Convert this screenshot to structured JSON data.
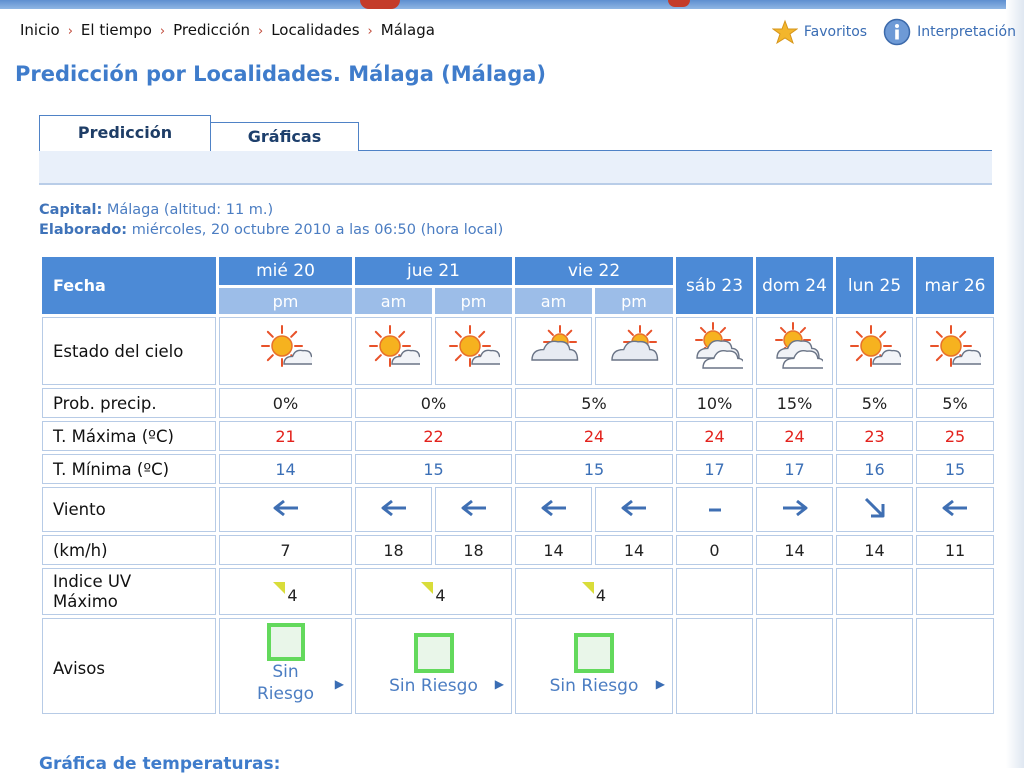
{
  "breadcrumb": [
    "Inicio",
    "El tiempo",
    "Predicción",
    "Localidades",
    "Málaga"
  ],
  "links": {
    "favoritos": "Favoritos",
    "interpretacion": "Interpretación"
  },
  "title": "Predicción por Localidades. Málaga (Málaga)",
  "tabs": {
    "prediccion": "Predicción",
    "graficas": "Gráficas"
  },
  "meta": {
    "capital_label": "Capital:",
    "capital_value": "Málaga (altitud: 11 m.)",
    "elaborado_label": "Elaborado:",
    "elaborado_value": "miércoles, 20 octubre 2010 a las 06:50 (hora local)"
  },
  "table": {
    "fecha": "Fecha",
    "days": [
      "mié 20",
      "jue 21",
      "vie 22",
      "sáb 23",
      "dom 24",
      "lun 25",
      "mar 26"
    ],
    "periods": [
      "pm",
      "am",
      "pm",
      "am",
      "pm"
    ],
    "labels": {
      "cielo": "Estado del cielo",
      "precip": "Prob. precip.",
      "tmax": "T. Máxima (ºC)",
      "tmin": "T. Mínima (ºC)",
      "viento": "Viento",
      "kmh": "(km/h)",
      "uv1": "Indice UV",
      "uv2": "Máximo",
      "avisos": "Avisos"
    },
    "sky_icons": [
      "sun-cloud-icon",
      "sun-cloud-icon",
      "sun-cloud-icon",
      "cloud-sun-icon",
      "cloud-sun-icon",
      "cloudy-sun-icon",
      "cloudy-sun-icon",
      "sun-cloud-icon",
      "sun-cloud-icon"
    ],
    "precip": [
      "0%",
      "0%",
      "5%",
      "10%",
      "15%",
      "5%",
      "5%"
    ],
    "tmax": [
      "21",
      "22",
      "24",
      "24",
      "24",
      "23",
      "25"
    ],
    "tmin": [
      "14",
      "15",
      "15",
      "17",
      "17",
      "16",
      "15"
    ],
    "wind_dirs": [
      "arrow-left-icon",
      "arrow-left-icon",
      "arrow-left-icon",
      "arrow-left-icon",
      "arrow-left-icon",
      "calm-dash-icon",
      "arrow-right-icon",
      "arrow-down-right-icon",
      "arrow-left-icon"
    ],
    "wind_speed": [
      "7",
      "18",
      "18",
      "14",
      "14",
      "0",
      "14",
      "14",
      "11"
    ],
    "uv": [
      "4",
      "4",
      "4"
    ],
    "aviso_text": [
      "Sin",
      "Riesgo",
      "Sin Riesgo",
      "Sin Riesgo"
    ]
  },
  "bottom_heading": "Gráfica de temperaturas:"
}
